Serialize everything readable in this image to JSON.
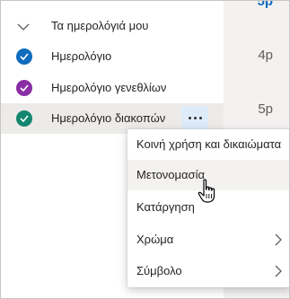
{
  "timeline": {
    "top_partial": "5p",
    "slot_1": "4p",
    "slot_2": "5p"
  },
  "calendar_group": {
    "title": "Τα ημερολόγιά μου",
    "calendars": [
      {
        "label": "Ημερολόγιο",
        "color": "#0f6cbd"
      },
      {
        "label": "Ημερολόγιο γενεθλίων",
        "color": "#8a2da5"
      },
      {
        "label": "Ημερολόγιο διακοπών",
        "color": "#13866f"
      }
    ]
  },
  "more_options_icon": "more-horizontal",
  "context_menu": {
    "items": [
      {
        "label": "Κοινή χρήση και δικαιώματα",
        "submenu": false
      },
      {
        "label": "Μετονομασία",
        "submenu": false
      },
      {
        "label": "Κατάργηση",
        "submenu": false
      },
      {
        "label": "Χρώμα",
        "submenu": true
      },
      {
        "label": "Σύμβολο",
        "submenu": true
      }
    ],
    "hovered_item": "Μετονομασία"
  }
}
